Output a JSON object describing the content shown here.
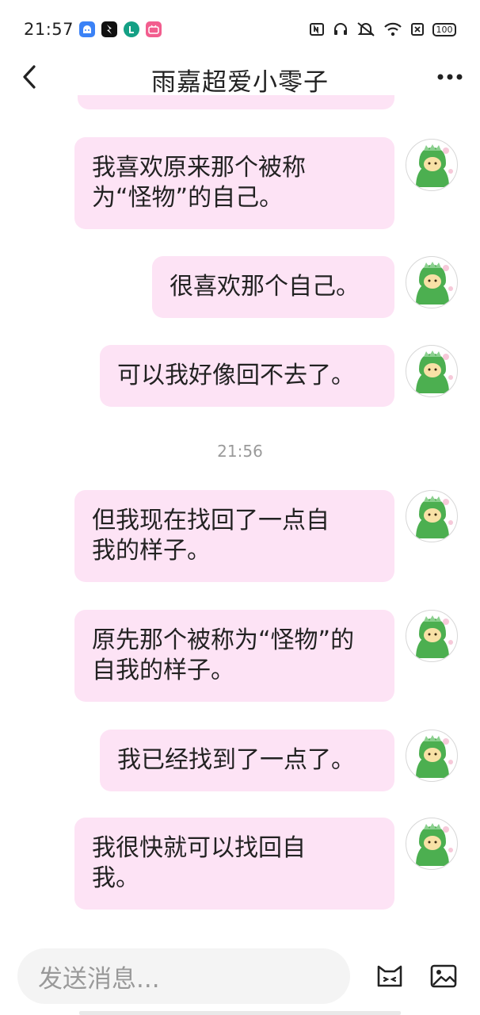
{
  "status_bar": {
    "time": "21:57",
    "app_icons": [
      "android-icon",
      "bolt-app-icon",
      "teal-l-app-icon",
      "bilibili-icon"
    ],
    "system_icons": [
      "nfc-icon",
      "headset-icon",
      "mute-bell-icon",
      "wifi-icon",
      "no-sim-icon"
    ],
    "battery": "100"
  },
  "header": {
    "title": "雨嘉超爱小零子",
    "back_icon": "chevron-left-icon",
    "more_icon": "more-dots-icon"
  },
  "colors": {
    "bubble_bg": "#fde3f5",
    "text": "#222222",
    "timestamp": "#9a9a9a",
    "input_bg": "#f4f4f4",
    "avatar_green": "#4caf50"
  },
  "messages": [
    {
      "text": "我喜欢原来那个被称\n为“怪物”的自己。"
    },
    {
      "text": "很喜欢那个自己。"
    },
    {
      "text": "可以我好像回不去了。"
    },
    {
      "timestamp": "21:56"
    },
    {
      "text": "但我现在找回了一点自\n我的样子。"
    },
    {
      "text": "原先那个被称为“怪物”的\n自我的样子。"
    },
    {
      "text": "我已经找到了一点了。"
    },
    {
      "text": "我很快就可以找回自\n我。"
    }
  ],
  "input": {
    "placeholder": "发送消息...",
    "emoji_icon": "cat-face-icon",
    "image_icon": "image-icon"
  }
}
